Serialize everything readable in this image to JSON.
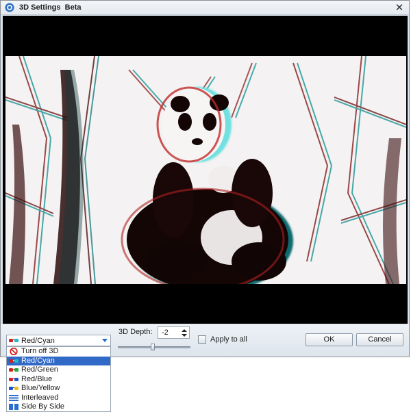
{
  "window": {
    "title": "3D Settings",
    "title_suffix": "Beta",
    "close_glyph": "✕"
  },
  "preview": {
    "description_icon": "panda-anaglyph-video-frame"
  },
  "mode_dropdown": {
    "selected": "Red/Cyan",
    "selected_icon": "red-cyan-glasses-icon",
    "options": [
      {
        "label": "Turn off 3D",
        "icon": "no-3d-icon"
      },
      {
        "label": "Red/Cyan",
        "icon": "red-cyan-glasses-icon"
      },
      {
        "label": "Red/Green",
        "icon": "red-green-glasses-icon"
      },
      {
        "label": "Red/Blue",
        "icon": "red-blue-glasses-icon"
      },
      {
        "label": "Blue/Yellow",
        "icon": "blue-yellow-glasses-icon"
      },
      {
        "label": "Interleaved",
        "icon": "interleaved-icon"
      },
      {
        "label": "Side By Side",
        "icon": "side-by-side-icon"
      }
    ],
    "highlighted_index": 1
  },
  "depth": {
    "label": "3D Depth:",
    "value": "-2"
  },
  "apply_all": {
    "label": "Apply to all",
    "checked": false
  },
  "buttons": {
    "ok": "OK",
    "cancel": "Cancel"
  },
  "colors": {
    "highlight": "#3169c6",
    "accent": "#1f6fc8"
  }
}
